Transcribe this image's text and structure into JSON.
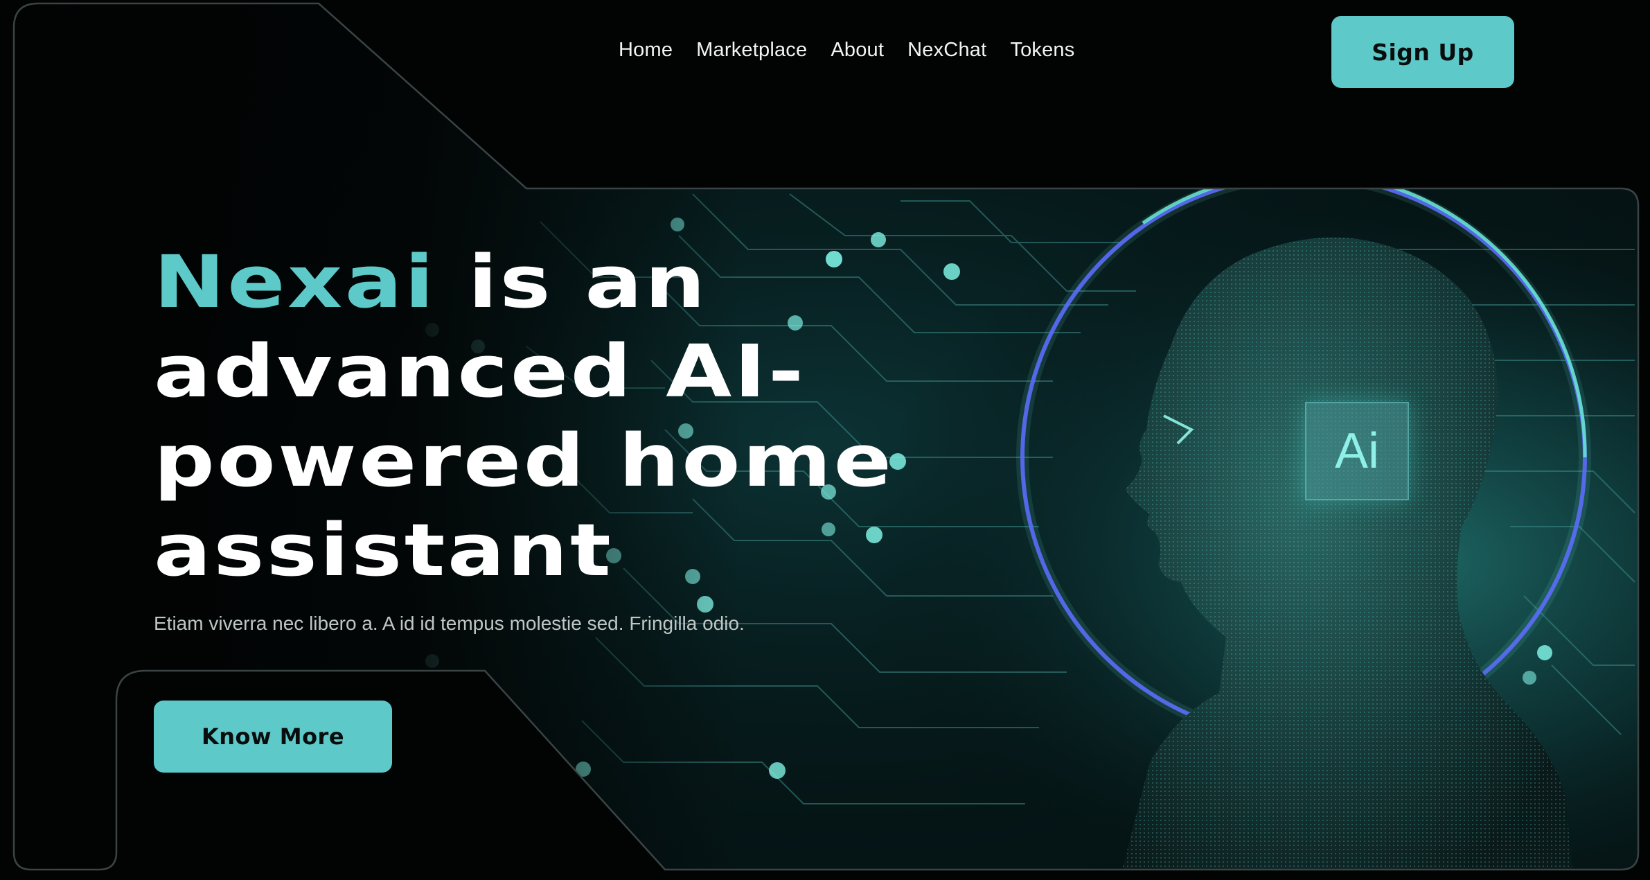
{
  "nav": {
    "items": [
      {
        "label": "Home"
      },
      {
        "label": "Marketplace"
      },
      {
        "label": "About"
      },
      {
        "label": "NexChat"
      },
      {
        "label": "Tokens"
      }
    ],
    "signup_label": "Sign Up"
  },
  "hero": {
    "brand": "Nexai",
    "headline_rest_line1": " is an",
    "headline_line2": "advanced AI-",
    "headline_line3": "powered home",
    "headline_line4": "assistant",
    "subtitle": "Etiam viverra nec libero a. A id id tempus molestie sed. Fringilla odio.",
    "cta_label": "Know More",
    "chip_label": "Ai"
  },
  "colors": {
    "accent": "#5ec9c9",
    "background": "#020303",
    "ring": "#5a5cff"
  },
  "icons": {
    "hero_art": "ai-head-illustration"
  }
}
